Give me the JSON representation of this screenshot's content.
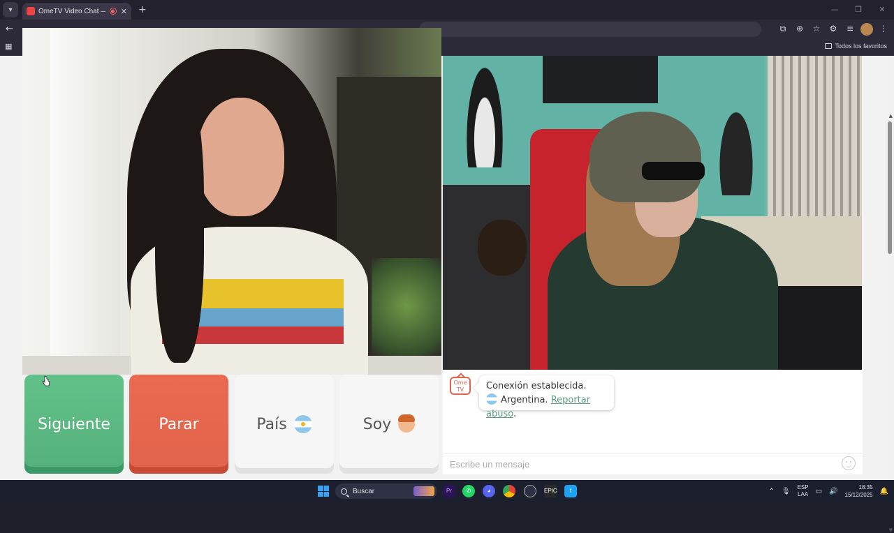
{
  "browser": {
    "tab_title": "OmeTV Video Chat — Ome",
    "tab_close": "✕",
    "new_tab": "+",
    "back": "←",
    "bookmark_bar": {
      "all_favorites": "Todos los favoritos"
    }
  },
  "controls": {
    "next_label": "Siguiente",
    "stop_label": "Parar",
    "country_label": "País",
    "me_label": "Soy"
  },
  "chat": {
    "logo_text": "Ome TV",
    "status_line": "Conexión establecida.",
    "country": "Argentina.",
    "report_link": "Reportar abuso",
    "report_suffix": ".",
    "input_placeholder": "Escribe un mensaje"
  },
  "taskbar": {
    "search_label": "Buscar",
    "lang_top": "ESP",
    "lang_bottom": "LAA",
    "time": "18:35",
    "date": "15/12/2025"
  }
}
